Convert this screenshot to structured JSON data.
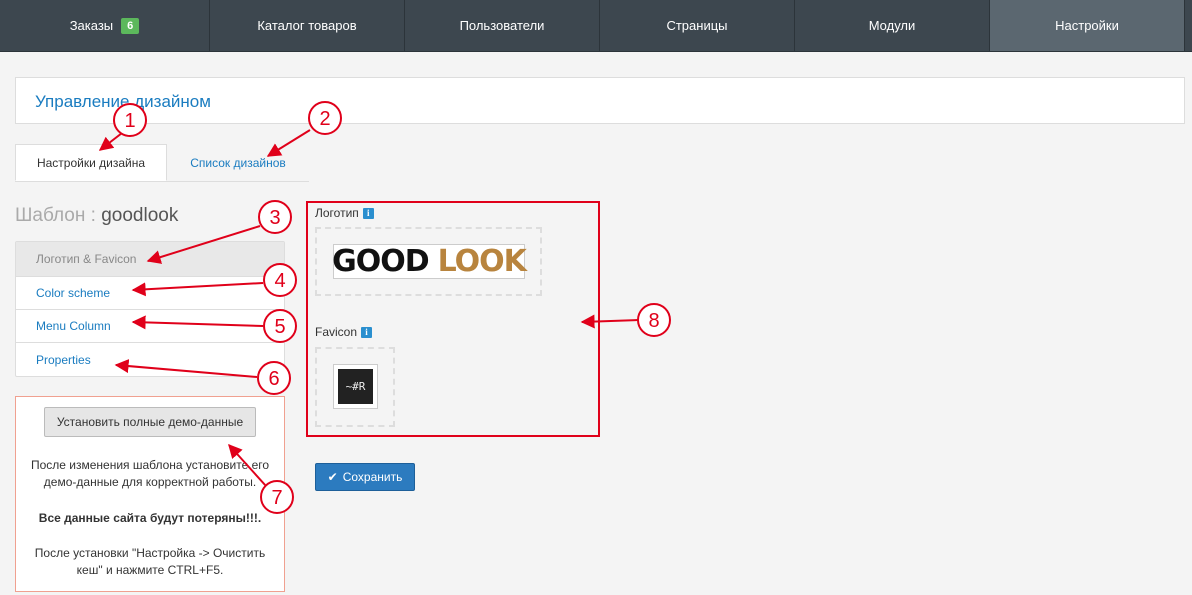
{
  "nav": {
    "items": [
      {
        "label": "Заказы",
        "badge": "6"
      },
      {
        "label": "Каталог товаров"
      },
      {
        "label": "Пользователи"
      },
      {
        "label": "Страницы"
      },
      {
        "label": "Модули"
      },
      {
        "label": "Настройки"
      }
    ],
    "active_index": 5
  },
  "page": {
    "title": "Управление дизайном"
  },
  "tabs": [
    {
      "label": "Настройки дизайна",
      "active": true
    },
    {
      "label": "Список дизайнов",
      "active": false
    }
  ],
  "template": {
    "label": "Шаблон :",
    "name": "goodlook"
  },
  "menu": {
    "items": [
      {
        "label": "Логотип & Favicon",
        "active": true
      },
      {
        "label": "Color scheme"
      },
      {
        "label": "Menu Column"
      },
      {
        "label": "Properties"
      }
    ]
  },
  "demo": {
    "button_label": "Установить полные демо-данные",
    "text1": "После изменения шаблона установите его демо-данные для корректной работы.",
    "text2": "Все данные сайта будут потеряны!!!.",
    "text3": "После установки \"Настройка -> Очистить кеш\" и нажмите CTRL+F5."
  },
  "logo": {
    "label": "Логотип",
    "info_glyph": "i",
    "image_text_1": "GOOD",
    "image_text_2": "LOOK"
  },
  "favicon": {
    "label": "Favicon",
    "info_glyph": "i",
    "image_text": "~#R"
  },
  "save_label": "Сохранить",
  "annotations": {
    "numbers": [
      "1",
      "2",
      "3",
      "4",
      "5",
      "6",
      "7",
      "8"
    ],
    "color": "#e0001a"
  },
  "colors": {
    "accent": "#1a7cc0",
    "nav_bg": "#3d474f",
    "nav_active": "#5b6770",
    "badge": "#5cb85c",
    "logo_gold": "#b8843e",
    "save_btn": "#2c7bbf"
  }
}
